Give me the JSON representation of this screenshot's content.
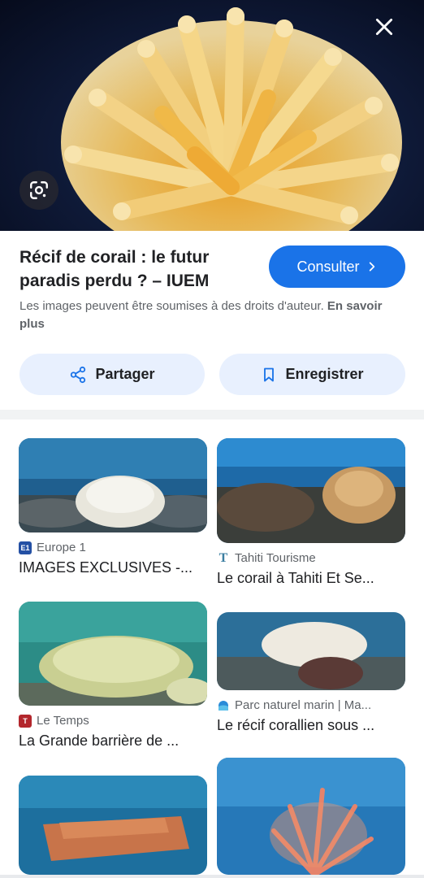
{
  "viewer": {
    "close_icon": "close-icon",
    "lens_icon": "google-lens-icon"
  },
  "result": {
    "title": "Récif de corail : le futur paradis perdu ? – IUEM",
    "visit_label": "Consulter",
    "copyright_text": "Les images peuvent être soumises à des droits d'auteur.",
    "learn_more": "En savoir plus",
    "share_label": "Partager",
    "save_label": "Enregistrer",
    "accent_color": "#1a73e8",
    "pill_color": "#e8f0fe"
  },
  "related": [
    {
      "source": "Europe 1",
      "title": "IMAGES EXCLUSIVES -...",
      "favicon": "E1",
      "favicon_color": "#2450a4"
    },
    {
      "source": "Tahiti Tourisme",
      "title": "Le corail à Tahiti Et Se...",
      "favicon": "T",
      "favicon_color": "#3b7ea1"
    },
    {
      "source": "Le Temps",
      "title": "La Grande barrière de ...",
      "favicon": "T",
      "favicon_color": "#b3262c"
    },
    {
      "source": "Parc naturel marin | Ma...",
      "title": "Le récif corallien sous ...",
      "favicon": "",
      "favicon_color": "#2a8bd8"
    },
    {
      "source": "",
      "title": ""
    },
    {
      "source": "",
      "title": ""
    }
  ]
}
